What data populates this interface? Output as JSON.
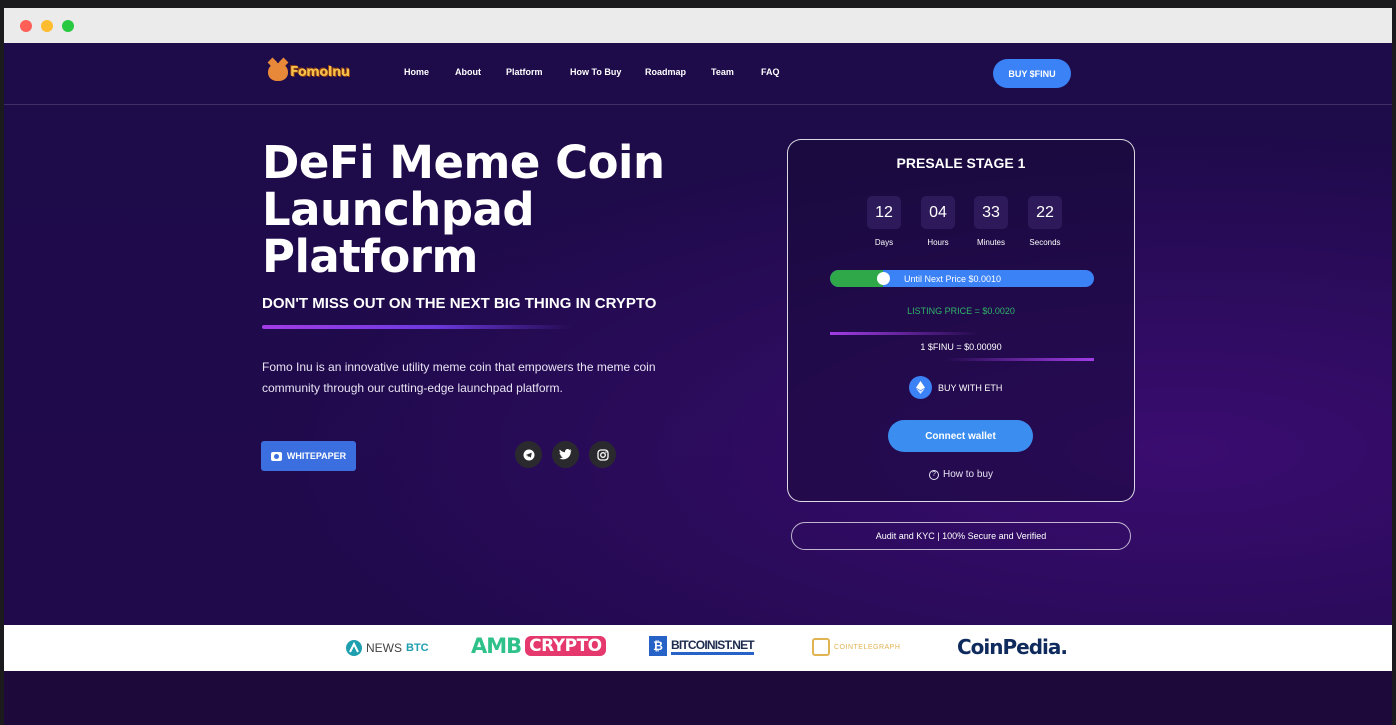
{
  "nav": {
    "logo_text": "FomoInu",
    "links": [
      "Home",
      "About",
      "Platform",
      "How To Buy",
      "Roadmap",
      "Team",
      "FAQ"
    ],
    "buy_button": "BUY $FINU"
  },
  "hero": {
    "title": "DeFi Meme Coin Launchpad Platform",
    "subtitle": "DON'T MISS OUT ON THE NEXT BIG THING IN CRYPTO",
    "description": "Fomo Inu is an innovative utility meme coin that empowers the meme coin community through our cutting-edge launchpad platform.",
    "whitepaper_button": "WHITEPAPER",
    "socials": [
      "telegram-icon",
      "twitter-icon",
      "instagram-icon"
    ]
  },
  "presale": {
    "title": "PRESALE STAGE 1",
    "countdown": [
      {
        "value": "12",
        "label": "Days"
      },
      {
        "value": "04",
        "label": "Hours"
      },
      {
        "value": "33",
        "label": "Minutes"
      },
      {
        "value": "22",
        "label": "Seconds"
      }
    ],
    "progress_fraction": 0.2,
    "progress_text": "Until Next Price $0.0010",
    "listing_price": "LISTING PRICE = $0.0020",
    "rate": "1 $FINU = $0.00090",
    "buy_with": "BUY WITH ETH",
    "connect_button": "Connect wallet",
    "how_to_buy": "How to buy"
  },
  "audit": "Audit and KYC | 100% Secure and Verified",
  "press": {
    "newsbtc_a": "NEWS",
    "newsbtc_b": "BTC",
    "amb_a": "AMB",
    "amb_b": "CRYPTO",
    "bitcoinist": "BITCOINIST.NET",
    "cointelegraph": "COINTELEGRAPH",
    "coinpedia": "CoinPedia."
  },
  "colors": {
    "accent_blue": "#3b82f6",
    "progress_green": "#2fa84a",
    "listing_green": "#2fb56a",
    "background": "#1e0b4a"
  }
}
